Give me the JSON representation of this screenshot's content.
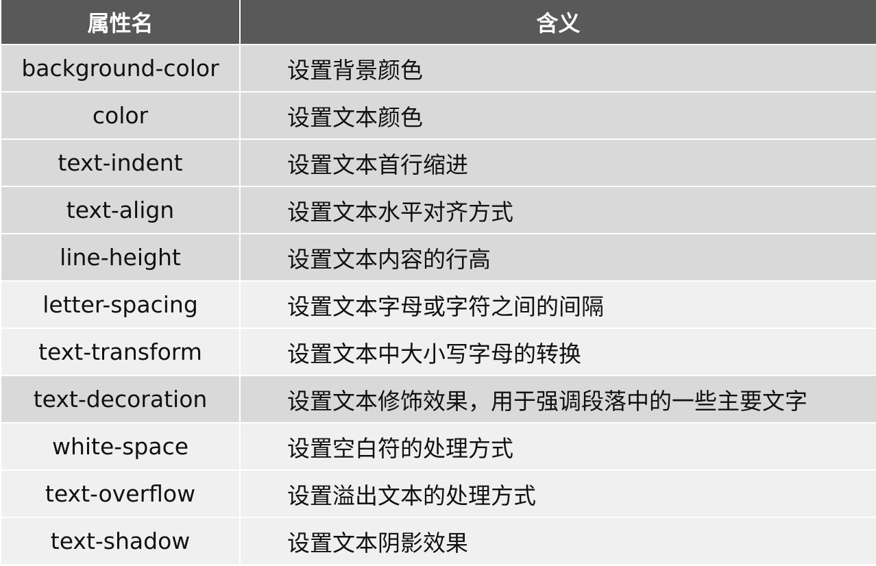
{
  "headers": [
    "属性名",
    "含义"
  ],
  "rows": [
    {
      "name": "background-color",
      "desc": "设置背景颜色",
      "shade": "dark"
    },
    {
      "name": "color",
      "desc": "设置文本颜色",
      "shade": "dark"
    },
    {
      "name": "text-indent",
      "desc": "设置文本首行缩进",
      "shade": "dark"
    },
    {
      "name": "text-align",
      "desc": "设置文本水平对齐方式",
      "shade": "dark"
    },
    {
      "name": "line-height",
      "desc": "设置文本内容的行高",
      "shade": "dark"
    },
    {
      "name": "letter-spacing",
      "desc": "设置文本字母或字符之间的间隔",
      "shade": "light"
    },
    {
      "name": "text-transform",
      "desc": "设置文本中大小写字母的转换",
      "shade": "light"
    },
    {
      "name": "text-decoration",
      "desc": "设置文本修饰效果，用于强调段落中的一些主要文字",
      "shade": "dark"
    },
    {
      "name": "white-space",
      "desc": "设置空白符的处理方式",
      "shade": "light"
    },
    {
      "name": "text-overflow",
      "desc": "设置溢出文本的处理方式",
      "shade": "light"
    },
    {
      "name": "text-shadow",
      "desc": "设置文本阴影效果",
      "shade": "light"
    }
  ],
  "colors": {
    "header_bg": "#595959",
    "row_dark": "#d9d9d9",
    "row_light": "#f0f0f0"
  }
}
